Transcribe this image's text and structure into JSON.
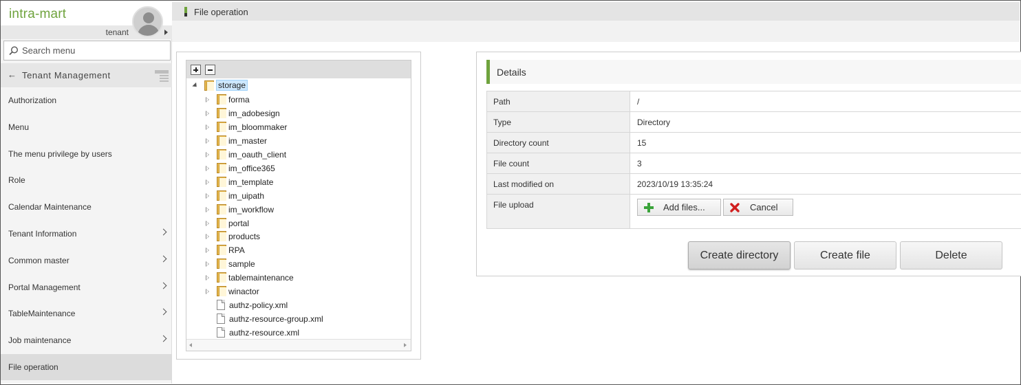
{
  "brand": {
    "name": "intra-mart"
  },
  "user": {
    "tenant_label": "tenant"
  },
  "search": {
    "placeholder": "Search menu"
  },
  "section": {
    "back_arrow": "←",
    "title": "Tenant Management"
  },
  "sidebar": {
    "items": [
      {
        "label": "Authorization",
        "has_children": false
      },
      {
        "label": "Menu",
        "has_children": false
      },
      {
        "label": "The menu privilege by users",
        "has_children": false
      },
      {
        "label": "Role",
        "has_children": false
      },
      {
        "label": "Calendar Maintenance",
        "has_children": false
      },
      {
        "label": "Tenant Information",
        "has_children": true
      },
      {
        "label": "Common master",
        "has_children": true
      },
      {
        "label": "Portal Management",
        "has_children": true
      },
      {
        "label": "TableMaintenance",
        "has_children": true
      },
      {
        "label": "Job maintenance",
        "has_children": true
      },
      {
        "label": "File operation",
        "has_children": false,
        "active": true
      }
    ]
  },
  "page": {
    "title": "File operation"
  },
  "tree": {
    "root": "storage",
    "folders": [
      "forma",
      "im_adobesign",
      "im_bloommaker",
      "im_master",
      "im_oauth_client",
      "im_office365",
      "im_template",
      "im_uipath",
      "im_workflow",
      "portal",
      "products",
      "RPA",
      "sample",
      "tablemaintenance",
      "winactor"
    ],
    "files": [
      "authz-policy.xml",
      "authz-resource-group.xml",
      "authz-resource.xml"
    ]
  },
  "details": {
    "heading": "Details",
    "rows": [
      {
        "key": "Path",
        "value": "/"
      },
      {
        "key": "Type",
        "value": "Directory"
      },
      {
        "key": "Directory count",
        "value": "15"
      },
      {
        "key": "File count",
        "value": "3"
      },
      {
        "key": "Last modified on",
        "value": "2023/10/19 13:35:24"
      }
    ],
    "upload": {
      "key": "File upload",
      "add_label": "Add files...",
      "cancel_label": "Cancel"
    }
  },
  "actions": {
    "create_directory": "Create directory",
    "create_file": "Create file",
    "delete": "Delete"
  },
  "colors": {
    "accent": "#6fa33d",
    "selection": "#cde8ff",
    "folder": "#e7b94f"
  }
}
